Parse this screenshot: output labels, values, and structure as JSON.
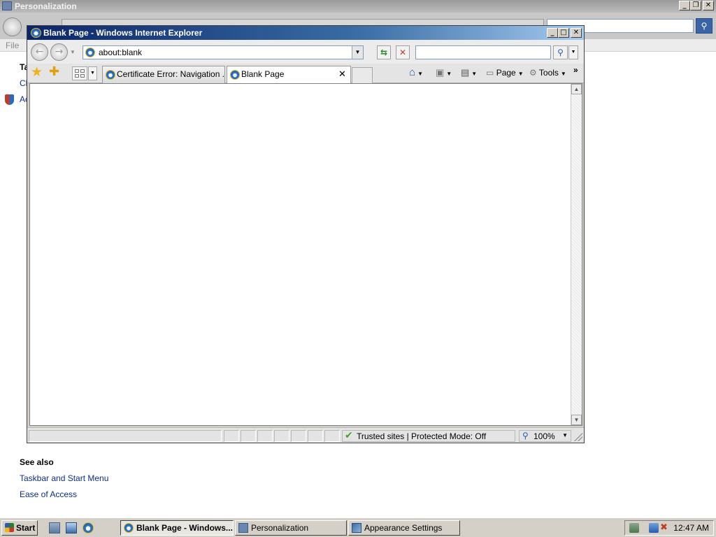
{
  "background_window": {
    "title": "Personalization",
    "menu_file": "File",
    "edge_texts": [
      "Ta",
      "Ch",
      "Ac"
    ],
    "see_also": {
      "heading": "See also",
      "links": [
        "Taskbar and Start Menu",
        "Ease of Access"
      ]
    }
  },
  "ie_window": {
    "title": "Blank Page - Windows Internet Explorer",
    "address": "about:blank",
    "search_value": "",
    "tabs": [
      {
        "label": "Certificate Error: Navigation ...",
        "active": false
      },
      {
        "label": "Blank Page",
        "active": true
      }
    ],
    "commands": {
      "page": "Page",
      "tools": "Tools"
    },
    "status": {
      "zone": "Trusted sites | Protected Mode: Off",
      "zoom": "100%"
    }
  },
  "taskbar": {
    "start_label": "Start",
    "buttons": [
      {
        "label": "Blank Page - Windows...",
        "active": true
      },
      {
        "label": "Personalization",
        "active": false
      },
      {
        "label": "Appearance Settings",
        "active": false
      }
    ],
    "clock": "12:47 AM"
  },
  "icons": {
    "back": "back-arrow-icon",
    "forward": "forward-arrow-icon",
    "refresh": "refresh-icon",
    "stop": "stop-icon",
    "search": "magnifier-icon",
    "favorites": "star-icon",
    "add_favorite": "star-plus-icon",
    "home": "home-icon",
    "feeds": "rss-feed-icon",
    "print": "printer-icon",
    "page": "page-icon",
    "tools": "gear-icon"
  },
  "colors": {
    "ie_title_gradient_start": "#0a246a",
    "ie_title_gradient_end": "#a6caf0",
    "link": "#0b2d8c",
    "trusted_check": "#4aa02c"
  }
}
